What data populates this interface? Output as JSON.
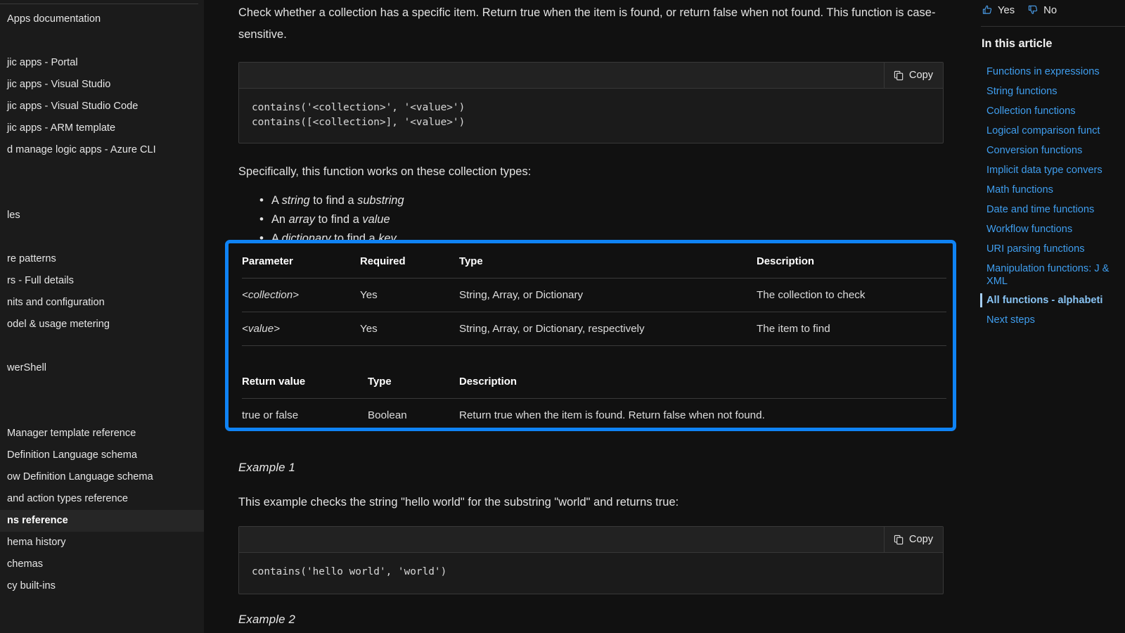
{
  "left_sidebar": {
    "items": [
      {
        "label": "Apps documentation",
        "kind": "item"
      },
      {
        "label": "",
        "kind": "spacer"
      },
      {
        "label": "jic apps - Portal",
        "kind": "item"
      },
      {
        "label": "jic apps - Visual Studio",
        "kind": "item"
      },
      {
        "label": "jic apps - Visual Studio Code",
        "kind": "item"
      },
      {
        "label": "jic apps - ARM template",
        "kind": "item"
      },
      {
        "label": "d manage logic apps - Azure CLI",
        "kind": "item"
      },
      {
        "label": "",
        "kind": "spacer"
      },
      {
        "label": "",
        "kind": "spacer"
      },
      {
        "label": "les",
        "kind": "item"
      },
      {
        "label": "",
        "kind": "spacer"
      },
      {
        "label": "re patterns",
        "kind": "item"
      },
      {
        "label": "rs - Full details",
        "kind": "item"
      },
      {
        "label": "nits and configuration",
        "kind": "item"
      },
      {
        "label": "odel & usage metering",
        "kind": "item"
      },
      {
        "label": "",
        "kind": "spacer"
      },
      {
        "label": "werShell",
        "kind": "item"
      },
      {
        "label": "",
        "kind": "spacer"
      },
      {
        "label": "",
        "kind": "spacer"
      },
      {
        "label": "Manager template reference",
        "kind": "item"
      },
      {
        "label": "Definition Language schema",
        "kind": "item"
      },
      {
        "label": "ow Definition Language schema",
        "kind": "item"
      },
      {
        "label": "and action types reference",
        "kind": "item"
      },
      {
        "label": "ns reference",
        "kind": "selected"
      },
      {
        "label": "hema history",
        "kind": "item"
      },
      {
        "label": "chemas",
        "kind": "item"
      },
      {
        "label": "cy built-ins",
        "kind": "item"
      }
    ]
  },
  "main": {
    "intro_paragraph": "Check whether a collection has a specific item. Return true when the item is found, or return false when not found. This function is case-sensitive.",
    "syntax_code": "contains('<collection>', '<value>')\ncontains([<collection>], '<value>')",
    "copy_label": "Copy",
    "copy_icon": "copy-icon",
    "types_lead": "Specifically, this function works on these collection types:",
    "types_list": [
      {
        "pre": "A ",
        "em1": "string",
        "mid": " to find a ",
        "em2": "substring"
      },
      {
        "pre": "An ",
        "em1": "array",
        "mid": " to find a ",
        "em2": "value"
      },
      {
        "pre": "A ",
        "em1": "dictionary",
        "mid": " to find a ",
        "em2": "key"
      }
    ],
    "params_table": {
      "headers": [
        "Parameter",
        "Required",
        "Type",
        "Description"
      ],
      "rows": [
        [
          "<collection>",
          "Yes",
          "String, Array, or Dictionary",
          "The collection to check"
        ],
        [
          "<value>",
          "Yes",
          "String, Array, or Dictionary, respectively",
          "The item to find"
        ]
      ]
    },
    "return_table": {
      "headers": [
        "Return value",
        "Type",
        "Description"
      ],
      "rows": [
        [
          "true or false",
          "Boolean",
          "Return true when the item is found. Return false when not found."
        ]
      ]
    },
    "example1_heading": "Example 1",
    "example1_text": "This example checks the string \"hello world\" for the substring \"world\" and returns true:",
    "example1_code": "contains('hello world', 'world')",
    "example2_heading": "Example 2"
  },
  "right_sidebar": {
    "feedback": {
      "yes_label": "Yes",
      "no_label": "No",
      "thumbs_up_icon": "thumbs-up-icon",
      "thumbs_down_icon": "thumbs-down-icon"
    },
    "toc_title": "In this article",
    "toc_items": [
      {
        "label": "Functions in expressions",
        "active": false
      },
      {
        "label": "String functions",
        "active": false
      },
      {
        "label": "Collection functions",
        "active": false
      },
      {
        "label": "Logical comparison funct",
        "active": false
      },
      {
        "label": "Conversion functions",
        "active": false
      },
      {
        "label": "Implicit data type convers",
        "active": false
      },
      {
        "label": "Math functions",
        "active": false
      },
      {
        "label": "Date and time functions",
        "active": false
      },
      {
        "label": "Workflow functions",
        "active": false
      },
      {
        "label": "URI parsing functions",
        "active": false
      },
      {
        "label": "Manipulation functions: J\n& XML",
        "active": false,
        "two_line": true
      },
      {
        "label": "All functions - alphabeti",
        "active": true
      },
      {
        "label": "Next steps",
        "active": false
      }
    ]
  },
  "colors": {
    "page_background": "#111111",
    "sidebar_background": "#1b1b1b",
    "highlight_border": "#0f83f5",
    "link_blue": "#3f9eef",
    "active_link_blue": "#89c4f4",
    "code_background": "#1b1b1b",
    "code_header_background": "#222222"
  }
}
